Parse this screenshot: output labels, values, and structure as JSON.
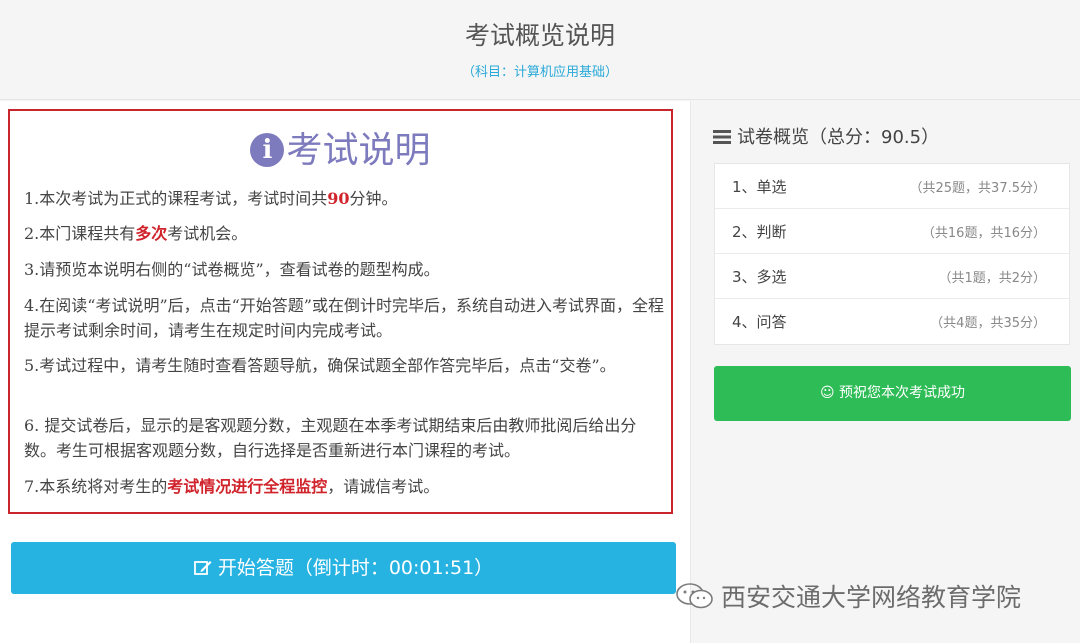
{
  "header": {
    "title": "考试概览说明",
    "subtitle": "（科目：计算机应用基础）"
  },
  "rules": {
    "icon": "info-circle-icon",
    "title": "考试说明",
    "items": [
      {
        "before": "1.本次考试为正式的课程考试，考试时间共",
        "highlight": "90",
        "after": "分钟。"
      },
      {
        "before": "2.本门课程共有",
        "highlight": "多次",
        "after": "考试机会。"
      },
      {
        "before": "3.请预览本说明右侧的“试卷概览”，查看试卷的题型构成。",
        "highlight": "",
        "after": ""
      },
      {
        "before": "4.在阅读“考试说明”后，点击“开始答题”或在倒计时完毕后，系统自动进入考试界面，全程提示考试剩余时间，请考生在规定时间内完成考试。",
        "highlight": "",
        "after": ""
      },
      {
        "before": "5.考试过程中，请考生随时查看答题导航，确保试题全部作答完毕后，点击“交卷”。",
        "highlight": "",
        "after": ""
      },
      {
        "before": "6. 提交试卷后，显示的是客观题分数，主观题在本季考试期结束后由教师批阅后给出分数。考生可根据客观题分数，自行选择是否重新进行本门课程的考试。",
        "highlight": "",
        "after": ""
      },
      {
        "before": "7.本系统将对考生的",
        "highlight": "考试情况进行全程监控",
        "after": "，请诚信考试。"
      }
    ]
  },
  "start_button": {
    "icon": "edit-icon",
    "label": "开始答题（倒计时：00:01:51）"
  },
  "overview": {
    "icon": "list-icon",
    "title": "试卷概览（总分：90.5）",
    "items": [
      {
        "name": "1、单选",
        "info": "（共25题，共37.5分）"
      },
      {
        "name": "2、判断",
        "info": "（共16题，共16分）"
      },
      {
        "name": "3、多选",
        "info": "（共1题，共2分）"
      },
      {
        "name": "4、问答",
        "info": "（共4题，共35分）"
      }
    ],
    "wish_button": "☺ 预祝您本次考试成功"
  },
  "watermark": {
    "icon": "wechat-icon",
    "text": "西安交通大学网络教育学院"
  },
  "colors": {
    "accent_blue": "#26b3e2",
    "success_green": "#2dbc55",
    "highlight_red": "#d0232b",
    "title_purple": "#7d7bbd"
  }
}
